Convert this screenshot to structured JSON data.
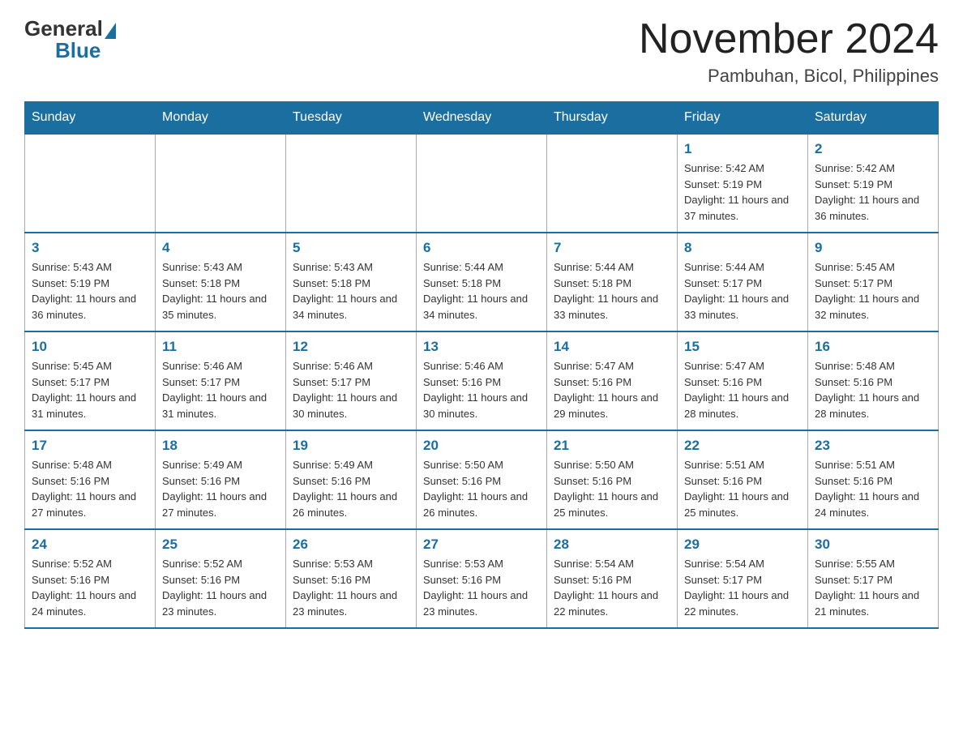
{
  "header": {
    "logo_general": "General",
    "logo_blue": "Blue",
    "month_title": "November 2024",
    "location": "Pambuhan, Bicol, Philippines"
  },
  "weekdays": [
    "Sunday",
    "Monday",
    "Tuesday",
    "Wednesday",
    "Thursday",
    "Friday",
    "Saturday"
  ],
  "weeks": [
    [
      {
        "day": "",
        "info": ""
      },
      {
        "day": "",
        "info": ""
      },
      {
        "day": "",
        "info": ""
      },
      {
        "day": "",
        "info": ""
      },
      {
        "day": "",
        "info": ""
      },
      {
        "day": "1",
        "info": "Sunrise: 5:42 AM\nSunset: 5:19 PM\nDaylight: 11 hours and 37 minutes."
      },
      {
        "day": "2",
        "info": "Sunrise: 5:42 AM\nSunset: 5:19 PM\nDaylight: 11 hours and 36 minutes."
      }
    ],
    [
      {
        "day": "3",
        "info": "Sunrise: 5:43 AM\nSunset: 5:19 PM\nDaylight: 11 hours and 36 minutes."
      },
      {
        "day": "4",
        "info": "Sunrise: 5:43 AM\nSunset: 5:18 PM\nDaylight: 11 hours and 35 minutes."
      },
      {
        "day": "5",
        "info": "Sunrise: 5:43 AM\nSunset: 5:18 PM\nDaylight: 11 hours and 34 minutes."
      },
      {
        "day": "6",
        "info": "Sunrise: 5:44 AM\nSunset: 5:18 PM\nDaylight: 11 hours and 34 minutes."
      },
      {
        "day": "7",
        "info": "Sunrise: 5:44 AM\nSunset: 5:18 PM\nDaylight: 11 hours and 33 minutes."
      },
      {
        "day": "8",
        "info": "Sunrise: 5:44 AM\nSunset: 5:17 PM\nDaylight: 11 hours and 33 minutes."
      },
      {
        "day": "9",
        "info": "Sunrise: 5:45 AM\nSunset: 5:17 PM\nDaylight: 11 hours and 32 minutes."
      }
    ],
    [
      {
        "day": "10",
        "info": "Sunrise: 5:45 AM\nSunset: 5:17 PM\nDaylight: 11 hours and 31 minutes."
      },
      {
        "day": "11",
        "info": "Sunrise: 5:46 AM\nSunset: 5:17 PM\nDaylight: 11 hours and 31 minutes."
      },
      {
        "day": "12",
        "info": "Sunrise: 5:46 AM\nSunset: 5:17 PM\nDaylight: 11 hours and 30 minutes."
      },
      {
        "day": "13",
        "info": "Sunrise: 5:46 AM\nSunset: 5:16 PM\nDaylight: 11 hours and 30 minutes."
      },
      {
        "day": "14",
        "info": "Sunrise: 5:47 AM\nSunset: 5:16 PM\nDaylight: 11 hours and 29 minutes."
      },
      {
        "day": "15",
        "info": "Sunrise: 5:47 AM\nSunset: 5:16 PM\nDaylight: 11 hours and 28 minutes."
      },
      {
        "day": "16",
        "info": "Sunrise: 5:48 AM\nSunset: 5:16 PM\nDaylight: 11 hours and 28 minutes."
      }
    ],
    [
      {
        "day": "17",
        "info": "Sunrise: 5:48 AM\nSunset: 5:16 PM\nDaylight: 11 hours and 27 minutes."
      },
      {
        "day": "18",
        "info": "Sunrise: 5:49 AM\nSunset: 5:16 PM\nDaylight: 11 hours and 27 minutes."
      },
      {
        "day": "19",
        "info": "Sunrise: 5:49 AM\nSunset: 5:16 PM\nDaylight: 11 hours and 26 minutes."
      },
      {
        "day": "20",
        "info": "Sunrise: 5:50 AM\nSunset: 5:16 PM\nDaylight: 11 hours and 26 minutes."
      },
      {
        "day": "21",
        "info": "Sunrise: 5:50 AM\nSunset: 5:16 PM\nDaylight: 11 hours and 25 minutes."
      },
      {
        "day": "22",
        "info": "Sunrise: 5:51 AM\nSunset: 5:16 PM\nDaylight: 11 hours and 25 minutes."
      },
      {
        "day": "23",
        "info": "Sunrise: 5:51 AM\nSunset: 5:16 PM\nDaylight: 11 hours and 24 minutes."
      }
    ],
    [
      {
        "day": "24",
        "info": "Sunrise: 5:52 AM\nSunset: 5:16 PM\nDaylight: 11 hours and 24 minutes."
      },
      {
        "day": "25",
        "info": "Sunrise: 5:52 AM\nSunset: 5:16 PM\nDaylight: 11 hours and 23 minutes."
      },
      {
        "day": "26",
        "info": "Sunrise: 5:53 AM\nSunset: 5:16 PM\nDaylight: 11 hours and 23 minutes."
      },
      {
        "day": "27",
        "info": "Sunrise: 5:53 AM\nSunset: 5:16 PM\nDaylight: 11 hours and 23 minutes."
      },
      {
        "day": "28",
        "info": "Sunrise: 5:54 AM\nSunset: 5:16 PM\nDaylight: 11 hours and 22 minutes."
      },
      {
        "day": "29",
        "info": "Sunrise: 5:54 AM\nSunset: 5:17 PM\nDaylight: 11 hours and 22 minutes."
      },
      {
        "day": "30",
        "info": "Sunrise: 5:55 AM\nSunset: 5:17 PM\nDaylight: 11 hours and 21 minutes."
      }
    ]
  ]
}
